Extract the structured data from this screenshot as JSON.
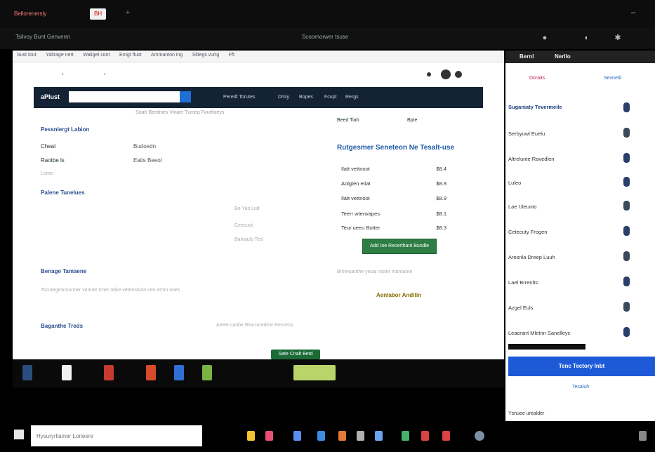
{
  "browser_tabs": [
    {
      "label": "Bellorenersly",
      "active": false
    },
    {
      "label": "BH",
      "active": true
    }
  ],
  "topbar": {
    "left_text": "Tsilvoy Bunt Genverm",
    "center_text": "Scoomorwer tsuse"
  },
  "bookmarks": [
    "Sust tout",
    "Yaltrage nert",
    "Waliget cont",
    "Erngt flust",
    "Ammanton ing",
    "Sltiegs vurtg",
    "Fft"
  ],
  "site": {
    "logo": "aPlust",
    "search_placeholder": "",
    "nav": [
      "Peredt Torutes",
      "Dmiy",
      "Bopes",
      "Fcupt",
      "Rergs"
    ],
    "subline": "Soatr Berdnies Vinaer Tumea Fourfioeys",
    "sections": {
      "overview_heading": "Pessnlergt Labion",
      "field1_label": "Cheat",
      "field1_value": "Budoedn",
      "field2_label": "Raotbe ls",
      "field2_value": "Eatis Beeol",
      "field3_label": "Lome",
      "detail_heading": "Palene Tunelues",
      "detail_values": [
        "Bo Yus Lud",
        "Ceecuut",
        "Baniauls Ted"
      ],
      "design_heading": "Benage Tamaene",
      "design_text": "Tscraegesnsunner vnnner rrner ndse vetenslunn nes ermn nnes",
      "related_heading": "Baganthe Treds",
      "related_text": "Aelee canbe Rea trnedine Renrens"
    },
    "rec": {
      "header_left": "Beed Tiah",
      "header_right": "Bpte",
      "title": "Rutgesmer Seneteon Ne Tesalt-use",
      "rows": [
        {
          "name": "Ilatt vettnoot",
          "price": "$8.4"
        },
        {
          "name": "Aolgten etiat",
          "price": "$8.8"
        },
        {
          "name": "Ilatt vettnoot",
          "price": "$8.9"
        },
        {
          "name": "Teerr wtenvapes",
          "price": "$8.1"
        },
        {
          "name": "Teur ueeu Botter",
          "price": "$8.3"
        }
      ],
      "button": "Add Ine Recerthant Bundle",
      "note": "Brtneuanthe yesal noiter mantanre",
      "vendor": "Aenlabor Anditin"
    },
    "chat_button": "Sate Cnalt Betd"
  },
  "panel": {
    "title_left": "Bernl",
    "title_right": "Nerllo",
    "tab1": "Doraits",
    "tab2": "Sexnetit",
    "list_heading": "Suganiaty Tevermeile",
    "items": [
      "Serbyuwl Euelu",
      "Altrelunte Ravedlen",
      "Luleo",
      "Lae Uleunto",
      "Cetecuty Frogen",
      "Aresnla Dreep Luuh",
      "Lael Brrenlts",
      "Azgel Euls",
      "Leacrant Mletnn Sanelleyc"
    ],
    "cta_button": "Tenc Tectory Inbt",
    "link": "Tesaluh",
    "footer": "Ysnuee urealder"
  },
  "taskbar": {
    "search_placeholder": "Hysuryrllamer Loneere"
  },
  "colors": {
    "site_nav": "#142235",
    "accent_blue": "#1e5ad8",
    "green_button": "#2e7d45"
  }
}
